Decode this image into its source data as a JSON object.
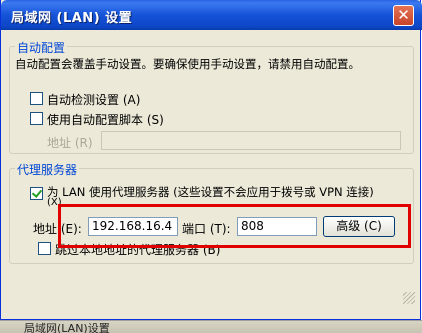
{
  "window": {
    "title": "局域网 (LAN) 设置",
    "close_glyph": "✕"
  },
  "auto_config": {
    "legend": "自动配置",
    "description": "自动配置会覆盖手动设置。要确保使用手动设置，请禁用自动配置。",
    "auto_detect_label": "自动检测设置 (A)",
    "auto_detect_checked": false,
    "use_script_label": "使用自动配置脚本 (S)",
    "use_script_checked": false,
    "address_label": "地址 (R)",
    "address_value": ""
  },
  "proxy": {
    "legend": "代理服务器",
    "use_proxy_label": "为 LAN 使用代理服务器 (这些设置不会应用于拨号或 VPN 连接)",
    "use_proxy_label_cont": "(X)",
    "use_proxy_checked": true,
    "address_label": "地址 (E):",
    "address_value": "192.168.16.4",
    "port_label": "端口 (T):",
    "port_value": "808",
    "advanced_button": "高级 (C)",
    "bypass_label": "跳过本地地址的代理服务器 (B)",
    "bypass_checked": false
  },
  "taskbar": {
    "item": "局域网(LAN)设置"
  },
  "colors": {
    "title_bar": "#0d45c6",
    "highlight_border": "#e00000",
    "legend_text": "#0046d5",
    "dialog_bg": "#ece9d8"
  }
}
